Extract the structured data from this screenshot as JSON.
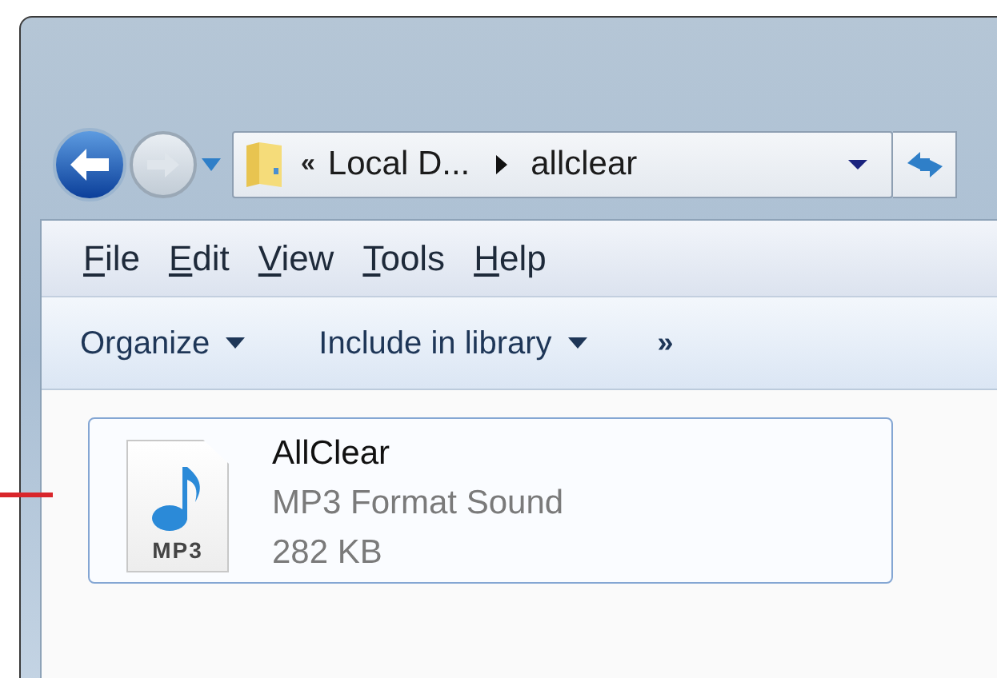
{
  "address_bar": {
    "overflow": "«",
    "crumbs": [
      {
        "label": "Local D..."
      },
      {
        "label": "allclear"
      }
    ]
  },
  "menu_bar": [
    {
      "label": "File"
    },
    {
      "label": "Edit"
    },
    {
      "label": "View"
    },
    {
      "label": "Tools"
    },
    {
      "label": "Help"
    }
  ],
  "command_bar": {
    "buttons": [
      {
        "label": "Organize"
      },
      {
        "label": "Include in library"
      }
    ],
    "more": "»"
  },
  "files": [
    {
      "name": "AllClear",
      "type": "MP3 Format Sound",
      "size": "282 KB",
      "icon_label": "MP3",
      "selected": true
    }
  ]
}
